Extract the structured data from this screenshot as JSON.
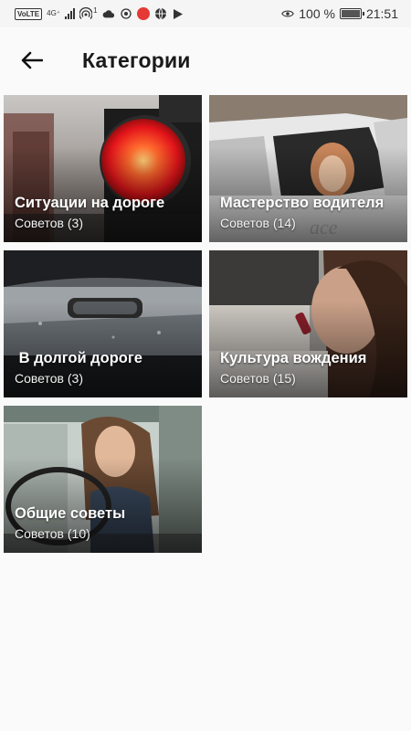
{
  "status_bar": {
    "volte": "VoLTE",
    "network": "4G⁺",
    "hotspot_count": "1",
    "battery": "100 %",
    "time": "21:51"
  },
  "app_bar": {
    "title": "Категории",
    "back_icon": "arrow-left-icon"
  },
  "categories": [
    {
      "title": "Ситуации на дороге",
      "count": "Советов (3)",
      "image": "traffic-light"
    },
    {
      "title": "Мастерство водителя",
      "count": "Советов (14)",
      "image": "woman-in-car-window"
    },
    {
      "title": " В долгой дороге",
      "count": "Советов (3)",
      "image": "rainy-windshield"
    },
    {
      "title": "Культура вождения",
      "count": "Советов (15)",
      "image": "woman-applying-lipstick"
    },
    {
      "title": "Общие советы",
      "count": "Советов (10)",
      "image": "woman-at-steering-wheel"
    }
  ],
  "colors": {
    "background": "#fafafa",
    "status_bar": "#f5f5f5",
    "title_text": "#1a1a1a",
    "card_text": "#ffffff"
  }
}
